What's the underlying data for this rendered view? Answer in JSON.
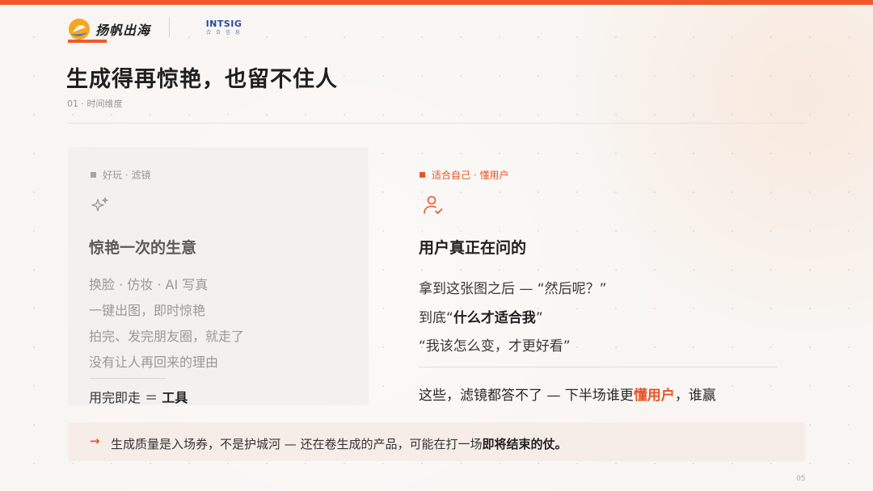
{
  "brand": {
    "logo_text": "扬帆出海",
    "partner_name": "INTSIG",
    "partner_sub": "合 合 信 息",
    "accent_color": "#f0592a"
  },
  "slide": {
    "title": "生成得再惊艳，也留不住人",
    "subtitle": "01 · 时间维度",
    "page_number": "05"
  },
  "left_card": {
    "tag": "好玩 · 滤镜",
    "icon": "sparkle-icon",
    "heading": "惊艳一次的生意",
    "lines": [
      "换脸 · 仿妆 · AI 写真",
      "一键出图，即时惊艳",
      "拍完、发完朋友圈，就走了",
      "没有让人再回来的理由"
    ],
    "footer_prefix": "用完即走 ＝ ",
    "footer_emphasis": "工具"
  },
  "right_card": {
    "tag": "适合自己 · 懂用户",
    "icon": "user-check-icon",
    "heading": "用户真正在问的",
    "line1": "拿到这张图之后 — “然后呢？”",
    "line2_prefix": "到底“",
    "line2_emphasis": "什么才适合我",
    "line2_suffix": "”",
    "line3": "“我该怎么变，才更好看”",
    "footer_prefix": "这些，滤镜都答不了 — 下半场谁更",
    "footer_highlight": "懂用户",
    "footer_suffix": "，谁赢"
  },
  "callout": {
    "arrow": "→",
    "text_prefix": "生成质量是入场券，不是护城河 — 还在卷生成的产品，可能在打一场",
    "text_emphasis": "即将结束的仗。"
  }
}
